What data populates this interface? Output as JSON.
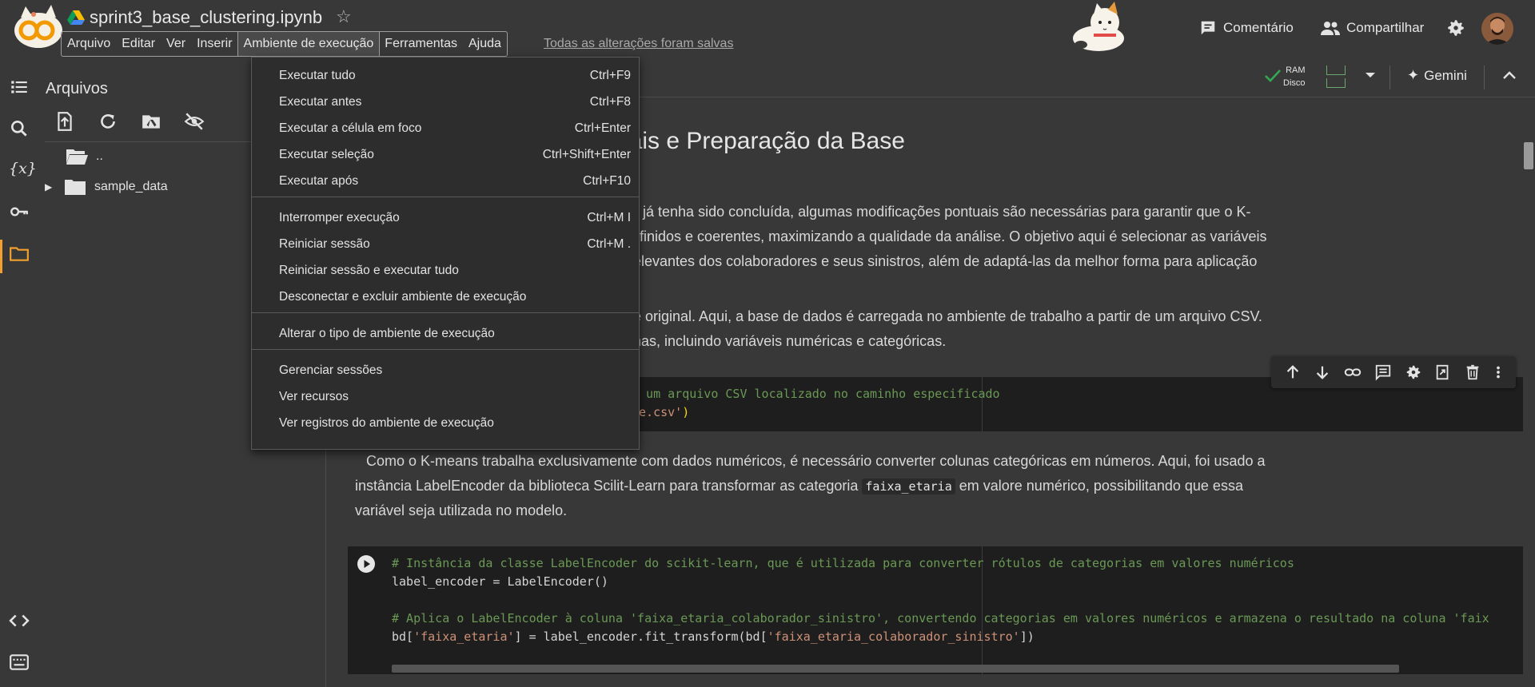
{
  "notebook": {
    "title": "sprint3_base_clustering.ipynb"
  },
  "menu": [
    "Arquivo",
    "Editar",
    "Ver",
    "Inserir",
    "Ambiente de execução",
    "Ferramentas",
    "Ajuda"
  ],
  "saved_status": "Todas as alterações foram salvas",
  "header": {
    "comment_label": "Comentário",
    "share_label": "Compartilhar"
  },
  "files": {
    "title": "Arquivos",
    "tree": [
      {
        "name": ".."
      },
      {
        "name": "sample_data"
      }
    ]
  },
  "toolbar": {
    "ram_label": "RAM",
    "disk_label": "Disco",
    "gemini_label": "Gemini"
  },
  "runtime_menu": {
    "groups": [
      [
        {
          "label": "Executar tudo",
          "shortcut": "Ctrl+F9"
        },
        {
          "label": "Executar antes",
          "shortcut": "Ctrl+F8"
        },
        {
          "label": "Executar a célula em foco",
          "shortcut": "Ctrl+Enter"
        },
        {
          "label": "Executar seleção",
          "shortcut": "Ctrl+Shift+Enter"
        },
        {
          "label": "Executar após",
          "shortcut": "Ctrl+F10"
        }
      ],
      [
        {
          "label": "Interromper execução",
          "shortcut": "Ctrl+M I"
        },
        {
          "label": "Reiniciar sessão",
          "shortcut": "Ctrl+M ."
        },
        {
          "label": "Reiniciar sessão e executar tudo",
          "shortcut": ""
        },
        {
          "label": "Desconectar e excluir ambiente de execução",
          "shortcut": ""
        }
      ],
      [
        {
          "label": "Alterar o tipo de ambiente de execução",
          "shortcut": ""
        }
      ],
      [
        {
          "label": "Gerenciar sessões",
          "shortcut": ""
        },
        {
          "label": "Ver recursos",
          "shortcut": ""
        },
        {
          "label": "Ver registros do ambiente de execução",
          "shortcut": ""
        }
      ]
    ]
  },
  "content": {
    "heading_visible": "eais e Preparação da Base",
    "para1": [
      "os já tenha sido concluída, algumas modificações pontuais são necessárias para garantir que o K-",
      "efinidos e coerentes, maximizando a qualidade da análise. O objetivo aqui é selecionar as variáveis",
      "elevantes dos colaboradores e seus sinistros, além de adaptá-las da melhor forma para aplicação"
    ],
    "para2": [
      "e original. Aqui, a base de dados é carregada no ambiente de trabalho a partir de um arquivo CSV.",
      "nas, incluindo variáveis numéricas e categóricas."
    ],
    "cell1": {
      "comment": "e um arquivo CSV localizado no caminho especificado",
      "line2_str": "le.csv'",
      "line2_close": ")"
    },
    "para3": {
      "line1": "Como o K-means trabalha exclusivamente com dados numéricos, é necessário converter colunas categóricas em números. Aqui, foi usado a",
      "line2_before": "instância LabelEncoder da biblioteca Scilit-Learn para transformar as categoria",
      "inline_code": "faixa_etaria",
      "line2_after": "em valore numérico, possibilitando que essa",
      "line3": "variável seja utilizada no modelo."
    },
    "cell2": {
      "line1": "# Instância da classe LabelEncoder do scikit-learn, que é utilizada para converter rótulos de categorias em valores numéricos",
      "line2": "label_encoder = LabelEncoder()",
      "line4": "# Aplica o LabelEncoder à coluna 'faixa_etaria_colaborador_sinistro', convertendo categorias em valores numéricos e armazena o resultado na coluna 'faix",
      "line5_a": "bd[",
      "line5_b": "'faixa_etaria'",
      "line5_c": "] = label_encoder.fit_transform(bd[",
      "line5_d": "'faixa_etaria_colaborador_sinistro'",
      "line5_e": "])"
    }
  },
  "colors": {
    "accent": "#f2a02e",
    "check": "#34a853",
    "background": "#383838",
    "menu_bg": "#2d2d2d"
  }
}
